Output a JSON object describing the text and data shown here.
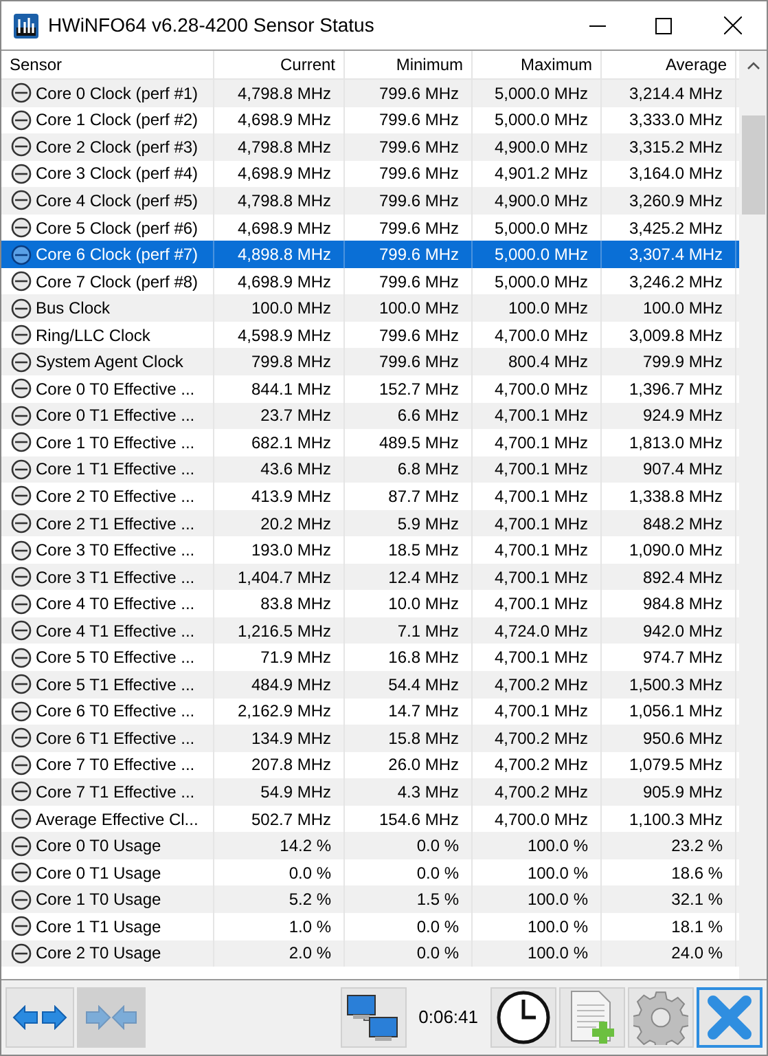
{
  "window": {
    "title": "HWiNFO64 v6.28-4200 Sensor Status"
  },
  "table": {
    "columns": [
      "Sensor",
      "Current",
      "Minimum",
      "Maximum",
      "Average"
    ],
    "rows": [
      {
        "sensor": "Core 0 Clock (perf #1)",
        "current": "4,798.8 MHz",
        "minimum": "799.6 MHz",
        "maximum": "5,000.0 MHz",
        "average": "3,214.4 MHz",
        "selected": false
      },
      {
        "sensor": "Core 1 Clock (perf #2)",
        "current": "4,698.9 MHz",
        "minimum": "799.6 MHz",
        "maximum": "5,000.0 MHz",
        "average": "3,333.0 MHz",
        "selected": false
      },
      {
        "sensor": "Core 2 Clock (perf #3)",
        "current": "4,798.8 MHz",
        "minimum": "799.6 MHz",
        "maximum": "4,900.0 MHz",
        "average": "3,315.2 MHz",
        "selected": false
      },
      {
        "sensor": "Core 3 Clock (perf #4)",
        "current": "4,698.9 MHz",
        "minimum": "799.6 MHz",
        "maximum": "4,901.2 MHz",
        "average": "3,164.0 MHz",
        "selected": false
      },
      {
        "sensor": "Core 4 Clock (perf #5)",
        "current": "4,798.8 MHz",
        "minimum": "799.6 MHz",
        "maximum": "4,900.0 MHz",
        "average": "3,260.9 MHz",
        "selected": false
      },
      {
        "sensor": "Core 5 Clock (perf #6)",
        "current": "4,698.9 MHz",
        "minimum": "799.6 MHz",
        "maximum": "5,000.0 MHz",
        "average": "3,425.2 MHz",
        "selected": false
      },
      {
        "sensor": "Core 6 Clock (perf #7)",
        "current": "4,898.8 MHz",
        "minimum": "799.6 MHz",
        "maximum": "5,000.0 MHz",
        "average": "3,307.4 MHz",
        "selected": true
      },
      {
        "sensor": "Core 7 Clock (perf #8)",
        "current": "4,698.9 MHz",
        "minimum": "799.6 MHz",
        "maximum": "5,000.0 MHz",
        "average": "3,246.2 MHz",
        "selected": false
      },
      {
        "sensor": "Bus Clock",
        "current": "100.0 MHz",
        "minimum": "100.0 MHz",
        "maximum": "100.0 MHz",
        "average": "100.0 MHz",
        "selected": false
      },
      {
        "sensor": "Ring/LLC Clock",
        "current": "4,598.9 MHz",
        "minimum": "799.6 MHz",
        "maximum": "4,700.0 MHz",
        "average": "3,009.8 MHz",
        "selected": false
      },
      {
        "sensor": "System Agent Clock",
        "current": "799.8 MHz",
        "minimum": "799.6 MHz",
        "maximum": "800.4 MHz",
        "average": "799.9 MHz",
        "selected": false
      },
      {
        "sensor": "Core 0 T0 Effective ...",
        "current": "844.1 MHz",
        "minimum": "152.7 MHz",
        "maximum": "4,700.0 MHz",
        "average": "1,396.7 MHz",
        "selected": false
      },
      {
        "sensor": "Core 0 T1 Effective ...",
        "current": "23.7 MHz",
        "minimum": "6.6 MHz",
        "maximum": "4,700.1 MHz",
        "average": "924.9 MHz",
        "selected": false
      },
      {
        "sensor": "Core 1 T0 Effective ...",
        "current": "682.1 MHz",
        "minimum": "489.5 MHz",
        "maximum": "4,700.1 MHz",
        "average": "1,813.0 MHz",
        "selected": false
      },
      {
        "sensor": "Core 1 T1 Effective ...",
        "current": "43.6 MHz",
        "minimum": "6.8 MHz",
        "maximum": "4,700.1 MHz",
        "average": "907.4 MHz",
        "selected": false
      },
      {
        "sensor": "Core 2 T0 Effective ...",
        "current": "413.9 MHz",
        "minimum": "87.7 MHz",
        "maximum": "4,700.1 MHz",
        "average": "1,338.8 MHz",
        "selected": false
      },
      {
        "sensor": "Core 2 T1 Effective ...",
        "current": "20.2 MHz",
        "minimum": "5.9 MHz",
        "maximum": "4,700.1 MHz",
        "average": "848.2 MHz",
        "selected": false
      },
      {
        "sensor": "Core 3 T0 Effective ...",
        "current": "193.0 MHz",
        "minimum": "18.5 MHz",
        "maximum": "4,700.1 MHz",
        "average": "1,090.0 MHz",
        "selected": false
      },
      {
        "sensor": "Core 3 T1 Effective ...",
        "current": "1,404.7 MHz",
        "minimum": "12.4 MHz",
        "maximum": "4,700.1 MHz",
        "average": "892.4 MHz",
        "selected": false
      },
      {
        "sensor": "Core 4 T0 Effective ...",
        "current": "83.8 MHz",
        "minimum": "10.0 MHz",
        "maximum": "4,700.1 MHz",
        "average": "984.8 MHz",
        "selected": false
      },
      {
        "sensor": "Core 4 T1 Effective ...",
        "current": "1,216.5 MHz",
        "minimum": "7.1 MHz",
        "maximum": "4,724.0 MHz",
        "average": "942.0 MHz",
        "selected": false
      },
      {
        "sensor": "Core 5 T0 Effective ...",
        "current": "71.9 MHz",
        "minimum": "16.8 MHz",
        "maximum": "4,700.1 MHz",
        "average": "974.7 MHz",
        "selected": false
      },
      {
        "sensor": "Core 5 T1 Effective ...",
        "current": "484.9 MHz",
        "minimum": "54.4 MHz",
        "maximum": "4,700.2 MHz",
        "average": "1,500.3 MHz",
        "selected": false
      },
      {
        "sensor": "Core 6 T0 Effective ...",
        "current": "2,162.9 MHz",
        "minimum": "14.7 MHz",
        "maximum": "4,700.1 MHz",
        "average": "1,056.1 MHz",
        "selected": false
      },
      {
        "sensor": "Core 6 T1 Effective ...",
        "current": "134.9 MHz",
        "minimum": "15.8 MHz",
        "maximum": "4,700.2 MHz",
        "average": "950.6 MHz",
        "selected": false
      },
      {
        "sensor": "Core 7 T0 Effective ...",
        "current": "207.8 MHz",
        "minimum": "26.0 MHz",
        "maximum": "4,700.2 MHz",
        "average": "1,079.5 MHz",
        "selected": false
      },
      {
        "sensor": "Core 7 T1 Effective ...",
        "current": "54.9 MHz",
        "minimum": "4.3 MHz",
        "maximum": "4,700.2 MHz",
        "average": "905.9 MHz",
        "selected": false
      },
      {
        "sensor": "Average Effective Cl...",
        "current": "502.7 MHz",
        "minimum": "154.6 MHz",
        "maximum": "4,700.0 MHz",
        "average": "1,100.3 MHz",
        "selected": false
      },
      {
        "sensor": "Core 0 T0 Usage",
        "current": "14.2 %",
        "minimum": "0.0 %",
        "maximum": "100.0 %",
        "average": "23.2 %",
        "selected": false
      },
      {
        "sensor": "Core 0 T1 Usage",
        "current": "0.0 %",
        "minimum": "0.0 %",
        "maximum": "100.0 %",
        "average": "18.6 %",
        "selected": false
      },
      {
        "sensor": "Core 1 T0 Usage",
        "current": "5.2 %",
        "minimum": "1.5 %",
        "maximum": "100.0 %",
        "average": "32.1 %",
        "selected": false
      },
      {
        "sensor": "Core 1 T1 Usage",
        "current": "1.0 %",
        "minimum": "0.0 %",
        "maximum": "100.0 %",
        "average": "18.1 %",
        "selected": false
      },
      {
        "sensor": "Core 2 T0 Usage",
        "current": "2.0 %",
        "minimum": "0.0 %",
        "maximum": "100.0 %",
        "average": "24.0 %",
        "selected": false
      }
    ]
  },
  "toolbar": {
    "buttons": [
      {
        "kind": "expand",
        "disabled": false,
        "focused": false
      },
      {
        "kind": "collapse",
        "disabled": true,
        "focused": false
      },
      {
        "kind": "network",
        "disabled": false,
        "focused": false
      },
      {
        "kind": "clock",
        "disabled": false,
        "focused": false
      },
      {
        "kind": "report",
        "disabled": false,
        "focused": false
      },
      {
        "kind": "settings",
        "disabled": false,
        "focused": false
      },
      {
        "kind": "close",
        "disabled": false,
        "focused": true
      }
    ],
    "timer": "0:06:41"
  }
}
